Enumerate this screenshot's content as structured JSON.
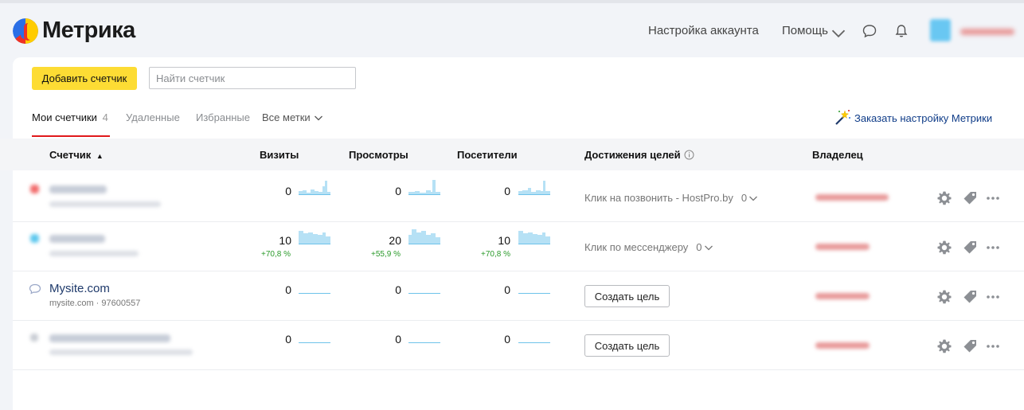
{
  "header": {
    "logo_text": "Метрика",
    "account_settings": "Настройка аккаунта",
    "help": "Помощь"
  },
  "toolbar": {
    "add_counter": "Добавить счетчик",
    "search_placeholder": "Найти счетчик"
  },
  "tabs": {
    "my_counters": "Мои счетчики",
    "my_counters_count": "4",
    "deleted": "Удаленные",
    "favorites": "Избранные",
    "all_tags": "Все метки",
    "order_setup": "Заказать настройку Метрики"
  },
  "columns": {
    "counter": "Счетчик",
    "sort_indicator": "▲",
    "visits": "Визиты",
    "views": "Просмотры",
    "visitors": "Посетители",
    "goals": "Достижения целей",
    "owner": "Владелец"
  },
  "rows": [
    {
      "visits": "0",
      "views": "0",
      "visitors": "0",
      "goal_text": "Клик на позвонить - HostPro.by",
      "goal_count": "0",
      "status_color": "#f26d6d"
    },
    {
      "visits": "10",
      "views": "20",
      "visitors": "10",
      "visits_delta": "+70,8 %",
      "views_delta": "+55,9 %",
      "visitors_delta": "+70,8 %",
      "goal_text": "Клик по мессенджеру",
      "goal_count": "0",
      "status_color": "#5ec8ee"
    },
    {
      "name": "Mysite.com",
      "sub": "mysite.com · 97600557",
      "visits": "0",
      "views": "0",
      "visitors": "0",
      "goal_button": "Создать цель"
    },
    {
      "visits": "0",
      "views": "0",
      "visitors": "0",
      "goal_button": "Создать цель"
    }
  ],
  "colors": {
    "accent_yellow": "#fddc34",
    "tab_underline": "#e0191b",
    "sparkline": "#b6e1f5",
    "delta_positive": "#2a9a2a",
    "link": "#0f3c88"
  }
}
